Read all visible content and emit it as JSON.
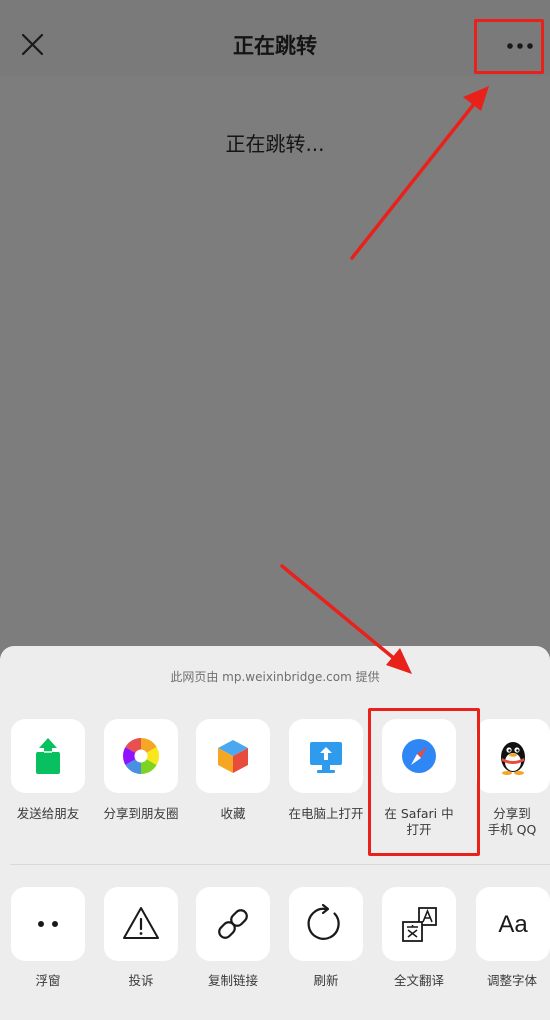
{
  "nav": {
    "title": "正在跳转"
  },
  "content": {
    "loading_text": "正在跳转..."
  },
  "sheet": {
    "provider_text": "此网页由 mp.weixinbridge.com 提供",
    "share_row": [
      {
        "label": "发送给朋友",
        "icon": "share-upload-icon"
      },
      {
        "label": "分享到朋友圈",
        "icon": "moments-aperture-icon"
      },
      {
        "label": "收藏",
        "icon": "favorite-cube-icon"
      },
      {
        "label": "在电脑上打开",
        "icon": "computer-upload-icon"
      },
      {
        "label_line1": "在 Safari 中",
        "label_line2": "打开",
        "icon": "safari-compass-icon"
      },
      {
        "label_line1": "分享到",
        "label_line2": "手机 QQ",
        "icon": "qq-penguin-icon"
      }
    ],
    "action_row": [
      {
        "label": "浮窗",
        "icon": "float-window-icon"
      },
      {
        "label": "投诉",
        "icon": "warning-icon"
      },
      {
        "label": "复制链接",
        "icon": "link-icon"
      },
      {
        "label": "刷新",
        "icon": "refresh-icon"
      },
      {
        "label": "全文翻译",
        "icon": "translate-icon"
      },
      {
        "label": "调整字体",
        "icon": "font-size-icon"
      }
    ]
  },
  "colors": {
    "overlay": "#7d7d7d",
    "sheet_bg": "#ededed",
    "annotation_red": "#e8211b",
    "wechat_green": "#07c160"
  }
}
